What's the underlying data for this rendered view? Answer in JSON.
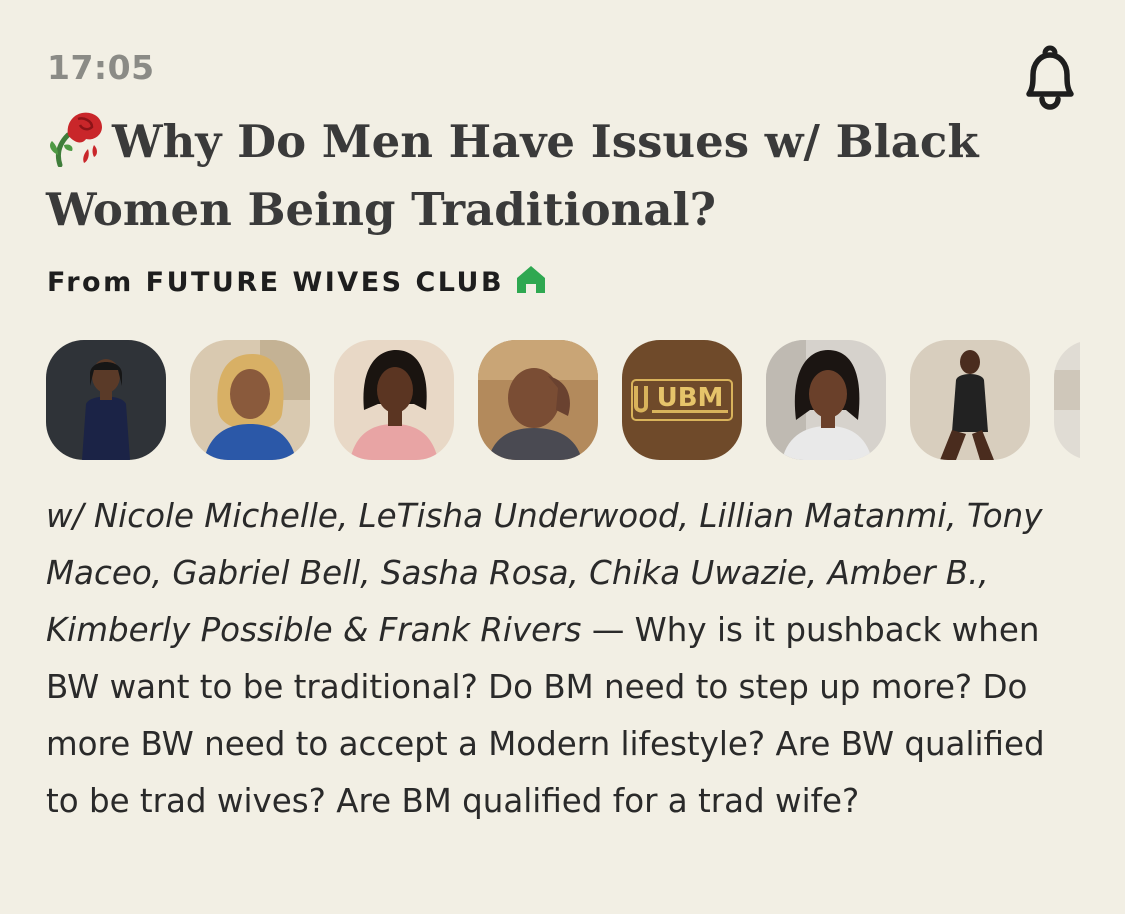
{
  "status": {
    "time": "17:05"
  },
  "room": {
    "title_icon": "wilted-rose-icon",
    "title": "Why Do Men Have Issues w/ Black Women Being Traditional?",
    "club_prefix": "From",
    "club_name": "FUTURE WIVES CLUB",
    "club_icon": "home-icon",
    "accent_color": "#2fa851"
  },
  "speakers": [
    {
      "name": "Nicole Michelle"
    },
    {
      "name": "LeTisha Underwood"
    },
    {
      "name": "Lillian Matanmi"
    },
    {
      "name": "Tony Maceo"
    },
    {
      "name": "Gabriel Bell",
      "avatar_logo_text": "UBM"
    },
    {
      "name": "Sasha Rosa"
    },
    {
      "name": "Chika Uwazie"
    },
    {
      "name": "Amber B."
    }
  ],
  "description": {
    "names_text": "w/ Nicole Michelle, LeTisha Underwood, Lillian Matanmi, Tony Maceo, Gabriel Bell, Sasha Rosa, Chika Uwazie, Amber B., Kimberly Possible & Frank Rivers",
    "separator": " — ",
    "body": "Why is it pushback when BW want to be traditional? Do BM need to step up more? Do more BW need to accept a Modern lifestyle? Are BW qualified to be trad wives? Are BM qualified for a trad wife?"
  },
  "icons": {
    "bell": "bell-icon"
  }
}
